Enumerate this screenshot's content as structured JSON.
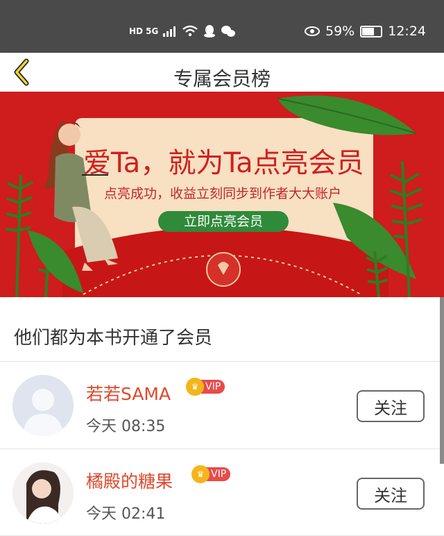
{
  "status_bar": {
    "left_icons": "HD 5G",
    "battery_percent": "59%",
    "battery_level": 0.59,
    "time": "12:24"
  },
  "nav": {
    "title": "专属会员榜",
    "back_icon": "chevron-left-icon"
  },
  "banner": {
    "headline": "爱Ta，就为Ta点亮会员",
    "subtitle": "点亮成功，收益立刻同步到作者大大账户",
    "button": "立即点亮会员"
  },
  "section": {
    "title": "他们都为本书开通了会员"
  },
  "members": [
    {
      "name": "若若SAMA",
      "vip": "VIP",
      "time": "今天 08:35",
      "follow": "关注",
      "avatar": "default-avatar"
    },
    {
      "name": "橘殿的糖果",
      "vip": "VIP",
      "time": "今天 02:41",
      "follow": "关注",
      "avatar": "photo-avatar"
    }
  ],
  "colors": {
    "accent": "#e0482b",
    "banner_red": "#cf1c1c",
    "leaf_green": "#3a8a2e",
    "vip_gold": "#f3b51b"
  }
}
